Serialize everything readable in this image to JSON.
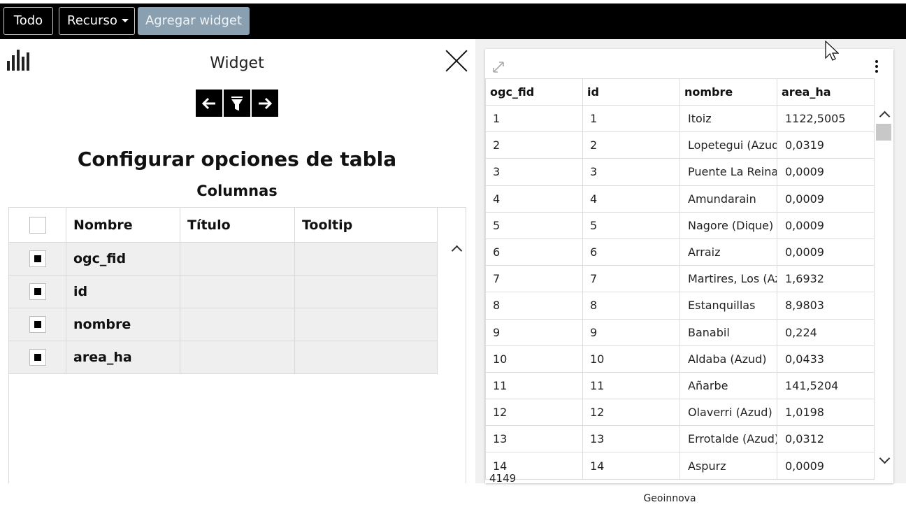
{
  "toolbar": {
    "todo_label": "Todo",
    "recurso_label": "Recurso",
    "agregar_label": "Agregar widget"
  },
  "left_panel": {
    "title": "Widget",
    "heading": "Configurar opciones de tabla",
    "subheading": "Columnas",
    "steps": [
      "←",
      "⏷",
      "→"
    ],
    "columns_table": {
      "headers": [
        "Nombre",
        "Título",
        "Tooltip"
      ],
      "rows": [
        {
          "nombre": "ogc_fid",
          "titulo": "",
          "tooltip": "",
          "checked": true
        },
        {
          "nombre": "id",
          "titulo": "",
          "tooltip": "",
          "checked": true
        },
        {
          "nombre": "nombre",
          "titulo": "",
          "tooltip": "",
          "checked": true
        },
        {
          "nombre": "area_ha",
          "titulo": "",
          "tooltip": "",
          "checked": true
        }
      ]
    }
  },
  "right_panel": {
    "headers": [
      "ogc_fid",
      "id",
      "nombre",
      "area_ha"
    ],
    "rows": [
      [
        "1",
        "1",
        "Itoiz",
        "1122,5005"
      ],
      [
        "2",
        "2",
        "Lopetegui (Azud)",
        "0,0319"
      ],
      [
        "3",
        "3",
        "Puente La Reina",
        "0,0009"
      ],
      [
        "4",
        "4",
        "Amundarain",
        "0,0009"
      ],
      [
        "5",
        "5",
        "Nagore (Dique)",
        "0,0009"
      ],
      [
        "6",
        "6",
        "Arraiz",
        "0,0009"
      ],
      [
        "7",
        "7",
        "Martires, Los (Azud)",
        "1,6932"
      ],
      [
        "8",
        "8",
        "Estanquillas",
        "8,9803"
      ],
      [
        "9",
        "9",
        "Banabil",
        "0,224"
      ],
      [
        "10",
        "10",
        "Aldaba (Azud)",
        "0,0433"
      ],
      [
        "11",
        "11",
        "Añarbe",
        "141,5204"
      ],
      [
        "12",
        "12",
        "Olaverri (Azud)",
        "1,0198"
      ],
      [
        "13",
        "13",
        "Errotalde (Azud)",
        "0,0312"
      ],
      [
        "14",
        "14",
        "Aspurz",
        "0,0009"
      ]
    ],
    "total_count": "4149"
  },
  "footer": {
    "text": "Geoinnova"
  },
  "colors": {
    "topbar": "#000000",
    "agregar_button": "#8aa0b1",
    "row_fill": "#efefef"
  }
}
